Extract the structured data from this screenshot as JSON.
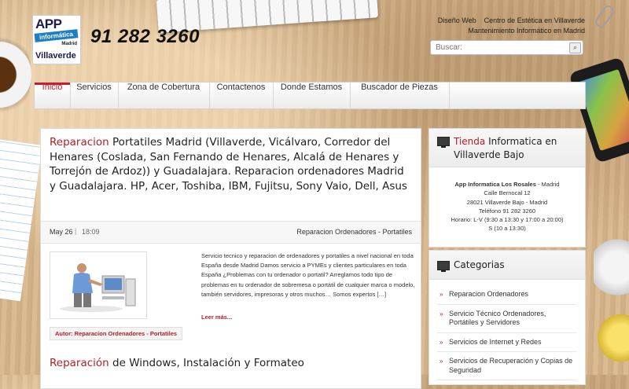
{
  "header": {
    "logo": {
      "app": "APP",
      "band": "informática",
      "madrid": "Madrid",
      "city": "Villaverde"
    },
    "phone": "91 282 3260",
    "top_links": [
      "Diseño Web",
      "Centro de Estética en Villaverde",
      "Mantenimiento Informático en Madrid"
    ],
    "search_placeholder": "Buscar:"
  },
  "nav": {
    "items": [
      "Inicio",
      "Servicios",
      "Zona de Cobertura",
      "Contactenos",
      "Donde Estamos",
      "Buscador de Piezas"
    ],
    "active": "Inicio"
  },
  "post": {
    "title_highlight": "Reparacion",
    "title_rest": " Portatiles Madrid (Villaverde, Vicálvaro, Corredor del Henares (Coslada, San Fernando de Henares, Alcalá de Henares y Torrejón de Ardoz)) y Guadalajara. Reparacion ordenadores Madrid y Guadalajara. HP, Acer, Toshiba, IBM, Fujitsu, Sony Vaio, Dell, Asus",
    "date": "May 26",
    "time": "18:09",
    "category": "Reparacion Ordenadores - Portatiles",
    "excerpt": "Servicio tecnico y reparacion de ordenadores y portatiles a nivel nacional en toda España desde Madrid Damos servicio a PYMEs y clientes particulares en toda España ¿Problemas con tu ordenador o portatil? Arreglamos todo tipo de problemas en tu ordenador de sobremesa o portátil de cualquier marca o modelo, también servidores, impresoras y otros muchos… Somos expertos […]",
    "read_more": "Leer más...",
    "author": "Autor: Reparacion Ordenadores - Portatiles"
  },
  "post2": {
    "title_highlight": "Reparación",
    "title_rest": " de Windows, Instalación y Formateo"
  },
  "sidebar": {
    "store": {
      "title_highlight": "Tienda",
      "title_rest": " Informatica en Villaverde Bajo",
      "name": "App Informatica Los Rosales",
      "name_suffix": " - Madrid",
      "address": "Calle Bernocal 12",
      "postal": "28021 Villaverde Bajo - Madrid",
      "phone": "Teléfono 91 282 3260",
      "hours1": "Horario: L-V (9:30 a 13:30 y 17:00 a 20:00)",
      "hours2": "S (10 a 13:30)"
    },
    "categories": {
      "title": "Categorias",
      "items": [
        "Reparacion Ordenadores",
        "Servicio Técnico Ordenadores, Portátiles y Servidores",
        "Servicios de Internet y Redes",
        "Servicios de Recuperación y Copias de Seguridad"
      ]
    }
  },
  "colors": {
    "accent": "#b01f27",
    "text": "#222222"
  }
}
